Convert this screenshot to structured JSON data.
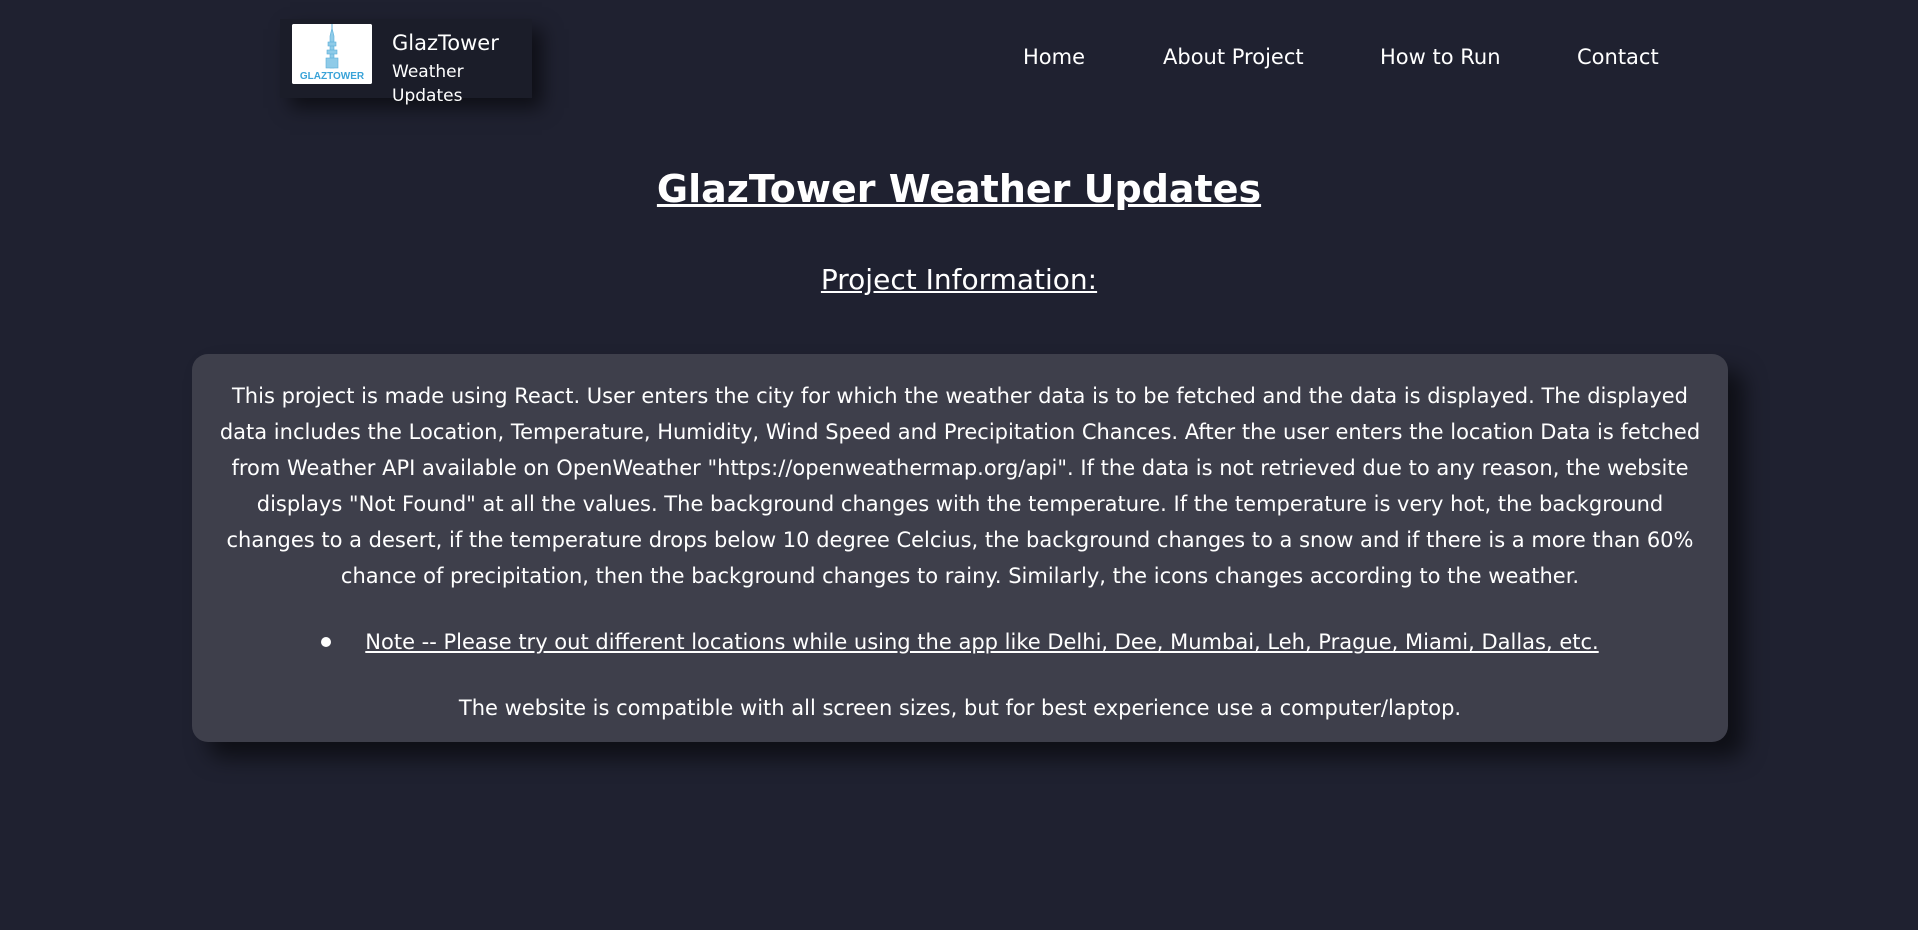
{
  "brand": {
    "name": "GlazTower",
    "subtitle": "Weather Updates",
    "logo_text": "GLAZTOWER",
    "logo_icon": "tower-logo"
  },
  "nav": {
    "items": [
      {
        "label": "Home"
      },
      {
        "label": "About Project"
      },
      {
        "label": "How to Run"
      },
      {
        "label": "Contact"
      }
    ]
  },
  "main": {
    "title": "GlazTower Weather Updates",
    "section_title": "Project Information:",
    "description": "This project is made using React. User enters the city for which the weather data is to be fetched and the data is displayed. The displayed data includes the Location, Temperature, Humidity, Wind Speed and Precipitation Chances. After the user enters the location Data is fetched from Weather API available on OpenWeather \"https://openweathermap.org/api\". If the data is not retrieved due to any reason, the website displays \"Not Found\" at all the values. The background changes with the temperature. If the temperature is very hot, the background changes to a desert, if the temperature drops below 10 degree Celcius, the background changes to a snow and if there is a more than 60% chance of precipitation, then the background changes to rainy. Similarly, the icons changes according to the weather.",
    "note": "Note -- Please try out different locations while using the app like Delhi, Dee, Mumbai, Leh, Prague, Miami, Dallas, etc.",
    "compatibility": "The website is compatible with all screen sizes, but for best experience use a computer/laptop."
  },
  "colors": {
    "background": "#1f2130",
    "card": "#3e3f4b",
    "brand_box": "#1b1d29",
    "text": "#ffffff",
    "logo_accent": "#3aa3d8"
  }
}
